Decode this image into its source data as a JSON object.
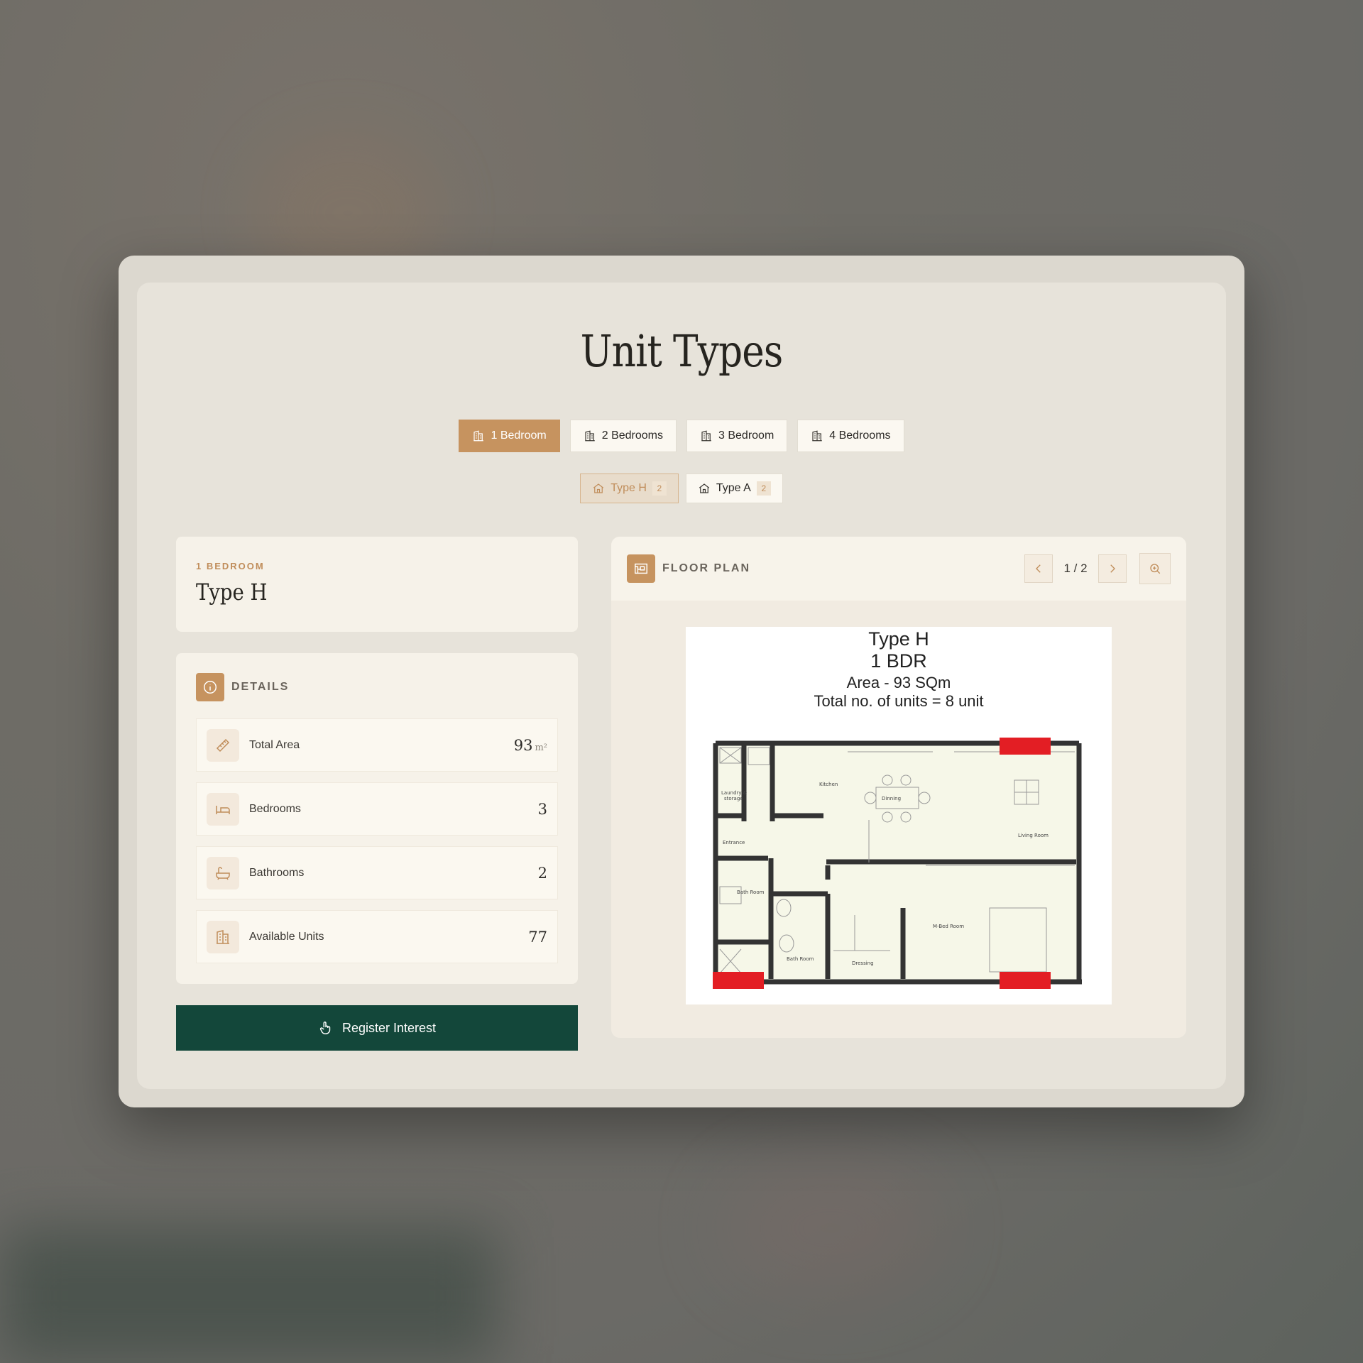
{
  "page": {
    "title": "Unit Types"
  },
  "bedroom_tabs": [
    {
      "label": "1 Bedroom",
      "active": true
    },
    {
      "label": "2 Bedrooms",
      "active": false
    },
    {
      "label": "3 Bedroom",
      "active": false
    },
    {
      "label": "4 Bedrooms",
      "active": false
    }
  ],
  "type_tabs": [
    {
      "label": "Type H",
      "count": "2",
      "active": true
    },
    {
      "label": "Type A",
      "count": "2",
      "active": false
    }
  ],
  "unit": {
    "category": "1 BEDROOM",
    "name": "Type H"
  },
  "details": {
    "heading": "DETAILS",
    "rows": [
      {
        "label": "Total Area",
        "value": "93",
        "unit": "m²",
        "icon": "ruler-icon"
      },
      {
        "label": "Bedrooms",
        "value": "3",
        "icon": "bed-icon"
      },
      {
        "label": "Bathrooms",
        "value": "2",
        "icon": "bathtub-icon"
      },
      {
        "label": "Available Units",
        "value": "77",
        "icon": "building-icon"
      }
    ]
  },
  "cta": {
    "label": "Register Interest"
  },
  "floor_plan": {
    "heading": "FLOOR PLAN",
    "page_indicator": "1 / 2",
    "sheet": {
      "line1": "Type H",
      "line2": "1 BDR",
      "line3": "Area - 93 SQm",
      "line4": "Total no. of units = 8 unit"
    }
  },
  "colors": {
    "accent": "#c6935f",
    "cta": "#13473a",
    "panel": "#e7e3da",
    "marker_red": "#e31e24"
  }
}
